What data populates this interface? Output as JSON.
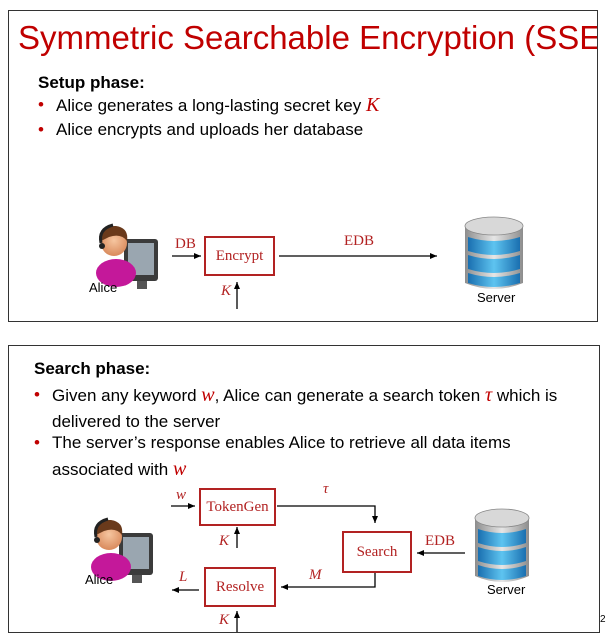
{
  "slide_title": "Symmetric Searchable Encryption (SSE)",
  "setup": {
    "heading": "Setup phase:",
    "bullets": [
      {
        "pre": "Alice generates a long-lasting secret key ",
        "sym": "K",
        "post": ""
      },
      {
        "pre": "Alice encrypts and uploads her database",
        "sym": "",
        "post": ""
      }
    ],
    "diagram": {
      "in_label": "DB",
      "box_label": "Encrypt",
      "out_label": "EDB",
      "key_label": "K",
      "alice_caption": "Alice",
      "server_caption": "Server"
    }
  },
  "search": {
    "heading": "Search phase:",
    "bullets": [
      {
        "line1_pre": "Given any keyword ",
        "line1_sym": "w",
        "line1_mid": ", Alice can generate a search token ",
        "line1_sym2": "τ",
        "line1_post": " which is",
        "line2": "delivered to the server"
      },
      {
        "line1": "The server’s response enables Alice to retrieve all data items",
        "line2_pre": "associated with ",
        "line2_sym": "w"
      }
    ],
    "diagram": {
      "tokengen_label": "TokenGen",
      "resolve_label": "Resolve",
      "search_label": "Search",
      "w_label": "w",
      "tau_label": "τ",
      "k1_label": "K",
      "k2_label": "K",
      "edb_label": "EDB",
      "m_label": "M",
      "l_label": "L",
      "alice_caption": "Alice",
      "server_caption": "Server"
    }
  },
  "page_number": "2",
  "colors": {
    "accent": "#c00000",
    "box": "#b22222",
    "server_top": "#1e88c8"
  }
}
